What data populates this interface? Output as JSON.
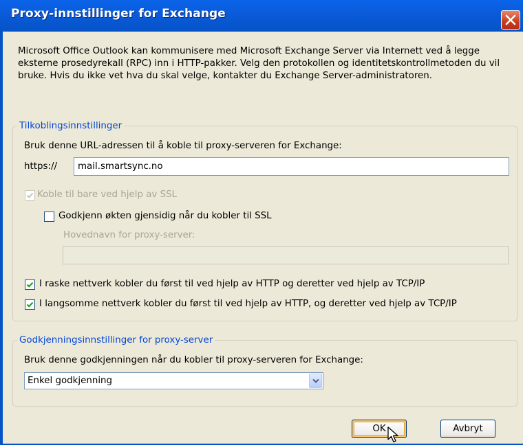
{
  "window": {
    "title": "Proxy-innstillinger for Exchange"
  },
  "intro": "Microsoft Office Outlook kan kommunisere med Microsoft Exchange Server via Internett ved å legge eksterne prosedyrekall (RPC) inn i HTTP-pakker. Velg den protokollen og identitetskontrollmetoden du vil bruke. Hvis du ikke vet hva du skal velge, kontakter du Exchange Server-administratoren.",
  "connection": {
    "legend": "Tilkoblingsinnstillinger",
    "url_label": "Bruk denne URL-adressen til å koble til proxy-serveren for Exchange:",
    "prefix": "https://",
    "url_value": "mail.smartsync.no",
    "ssl_only_label": "Koble til bare ved hjelp av SSL",
    "ssl_only_checked": true,
    "mutual_auth_label": "Godkjenn økten gjensidig når du kobler til SSL",
    "mutual_auth_checked": false,
    "principal_label": "Hovednavn for proxy-server:",
    "principal_value": "",
    "fast_label": "I raske nettverk kobler du først til ved hjelp av HTTP og deretter ved hjelp av TCP/IP",
    "fast_checked": true,
    "slow_label": "I langsomme nettverk kobler du først til ved hjelp av HTTP, og deretter ved hjelp av TCP/IP",
    "slow_checked": true
  },
  "auth": {
    "legend": "Godkjenningsinnstillinger for proxy-server",
    "label": "Bruk denne godkjenningen når du kobler til proxy-serveren for Exchange:",
    "selected": "Enkel godkjenning"
  },
  "buttons": {
    "ok": "OK",
    "cancel": "Avbryt"
  },
  "colors": {
    "titlebar": "#0453c7",
    "dialog_bg": "#ece9d8",
    "group_title": "#0046d5",
    "checkmark": "#21a121",
    "close": "#c93d1b"
  }
}
